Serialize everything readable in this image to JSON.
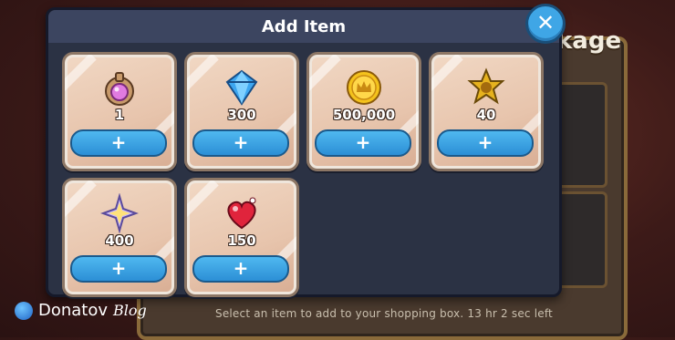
{
  "background": {
    "title_fragment": "kage",
    "hint": "Select an item to add to your shopping box. 13 hr 2 sec left"
  },
  "modal": {
    "title": "Add Item",
    "close_label": "✕",
    "items": [
      {
        "icon": "potion-pouch-icon",
        "qty": "1",
        "add_label": "+"
      },
      {
        "icon": "blue-crystal-icon",
        "qty": "300",
        "add_label": "+"
      },
      {
        "icon": "gold-coin-icon",
        "qty": "500,000",
        "add_label": "+"
      },
      {
        "icon": "golden-star-ornament-icon",
        "qty": "40",
        "add_label": "+"
      },
      {
        "icon": "rainbow-star-shard-icon",
        "qty": "400",
        "add_label": "+"
      },
      {
        "icon": "red-heart-jelly-icon",
        "qty": "150",
        "add_label": "+"
      }
    ]
  },
  "watermark": {
    "brand": "Donatov",
    "suffix": "Blog"
  },
  "colors": {
    "modal_bg": "#2b3244",
    "button_blue": "#3fa6e6",
    "card_bg": "#f1d8c4"
  }
}
